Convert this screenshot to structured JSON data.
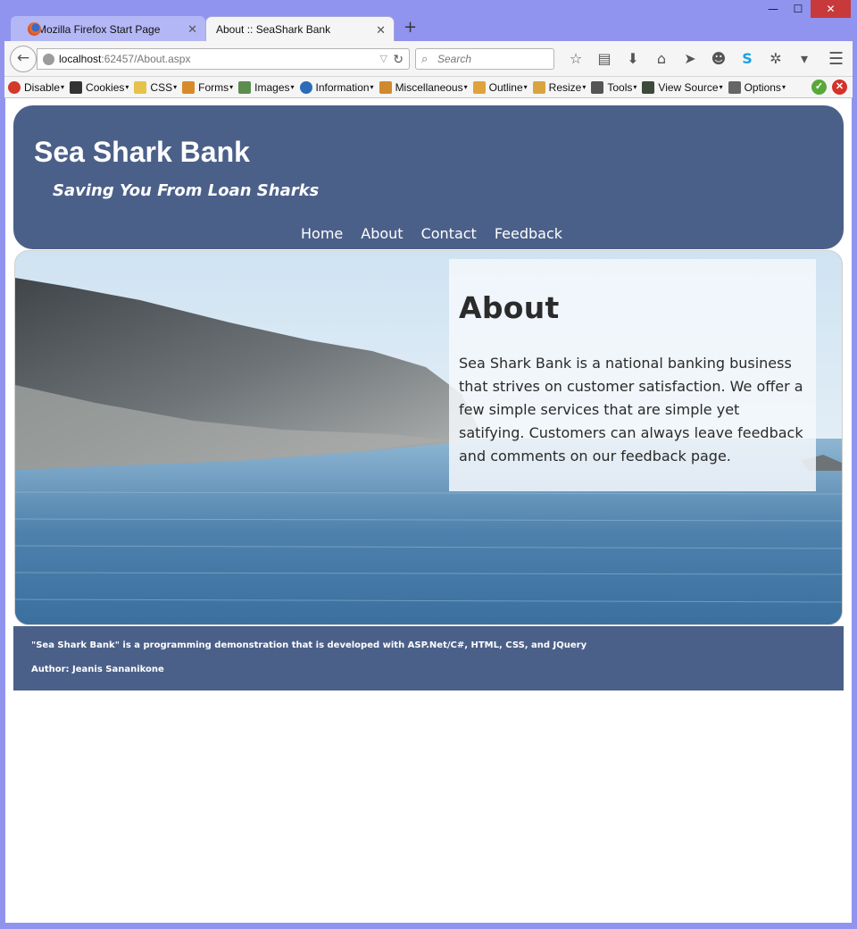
{
  "browser": {
    "tabs": [
      {
        "label": "Mozilla Firefox Start Page",
        "active": false
      },
      {
        "label": "About :: SeaShark Bank",
        "active": true
      }
    ],
    "url_host": "localhost",
    "url_rest": ":62457/About.aspx",
    "search_placeholder": "Search",
    "window_controls": {
      "minimize": "—",
      "maximize": "☐",
      "close": "✕"
    },
    "toolbar_icons": [
      "star-icon",
      "reading-list-icon",
      "download-icon",
      "home-icon",
      "send-icon",
      "emoji-icon",
      "skype-icon",
      "bug-icon",
      "dropdown-icon",
      "menu-icon"
    ]
  },
  "devbar": {
    "items": [
      {
        "label": "Disable",
        "icon": "disable-icon",
        "color": "#d33a2c"
      },
      {
        "label": "Cookies",
        "icon": "cookies-icon",
        "color": "#333333"
      },
      {
        "label": "CSS",
        "icon": "css-icon",
        "color": "#e5c34a"
      },
      {
        "label": "Forms",
        "icon": "forms-icon",
        "color": "#d88a2a"
      },
      {
        "label": "Images",
        "icon": "images-icon",
        "color": "#5c8d4e"
      },
      {
        "label": "Information",
        "icon": "information-icon",
        "color": "#2b6bb8"
      },
      {
        "label": "Miscellaneous",
        "icon": "miscellaneous-icon",
        "color": "#d08a2d"
      },
      {
        "label": "Outline",
        "icon": "outline-icon",
        "color": "#e0a23a"
      },
      {
        "label": "Resize",
        "icon": "resize-icon",
        "color": "#d9a440"
      },
      {
        "label": "Tools",
        "icon": "tools-icon",
        "color": "#555555"
      },
      {
        "label": "View Source",
        "icon": "view-source-icon",
        "color": "#3c4a3a"
      },
      {
        "label": "Options",
        "icon": "options-icon",
        "color": "#666666"
      }
    ]
  },
  "site": {
    "title": "Sea Shark Bank",
    "tagline": "Saving You From Loan Sharks",
    "nav": [
      "Home",
      "About",
      "Contact",
      "Feedback"
    ],
    "about_heading": "About",
    "about_text": "Sea Shark Bank is a national banking business that strives on customer satisfaction. We offer a few simple services that are simple yet satifying. Customers can always leave feedback and comments on our feedback page.",
    "footer_line1": "\"Sea Shark Bank\" is a programming demonstration that is developed with ASP.Net/C#, HTML, CSS, and JQuery",
    "footer_line2": "Author: Jeanis Sananikone"
  },
  "colors": {
    "header_bg": "#4b6089",
    "window_frame": "#9094ee",
    "close_button": "#c7393b"
  }
}
